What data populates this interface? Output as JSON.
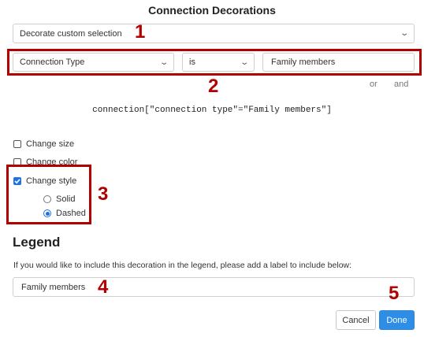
{
  "dialog": {
    "title": "Connection Decorations"
  },
  "selection": {
    "mode_value": "Decorate custom selection"
  },
  "filter": {
    "field_value": "Connection Type",
    "operator_value": "is",
    "value_input": "Family members",
    "or_label": "or",
    "and_label": "and",
    "query": "connection[\"connection type\"=\"Family members\"]"
  },
  "options": {
    "change_size": {
      "label": "Change size",
      "checked": false
    },
    "change_color": {
      "label": "Change color",
      "checked": false
    },
    "change_style": {
      "label": "Change style",
      "checked": true
    },
    "style_solid": {
      "label": "Solid",
      "selected": false
    },
    "style_dashed": {
      "label": "Dashed",
      "selected": true
    }
  },
  "legend": {
    "heading": "Legend",
    "help_text": "If you would like to include this decoration in the legend, please add a label to include below:",
    "label_value": "Family members"
  },
  "buttons": {
    "cancel_label": "Cancel",
    "done_label": "Done"
  },
  "annotations": {
    "n1": "1",
    "n2": "2",
    "n3": "3",
    "n4": "4",
    "n5": "5"
  },
  "colors": {
    "annotation_red": "#b00000",
    "primary_blue": "#2e8ee6"
  }
}
